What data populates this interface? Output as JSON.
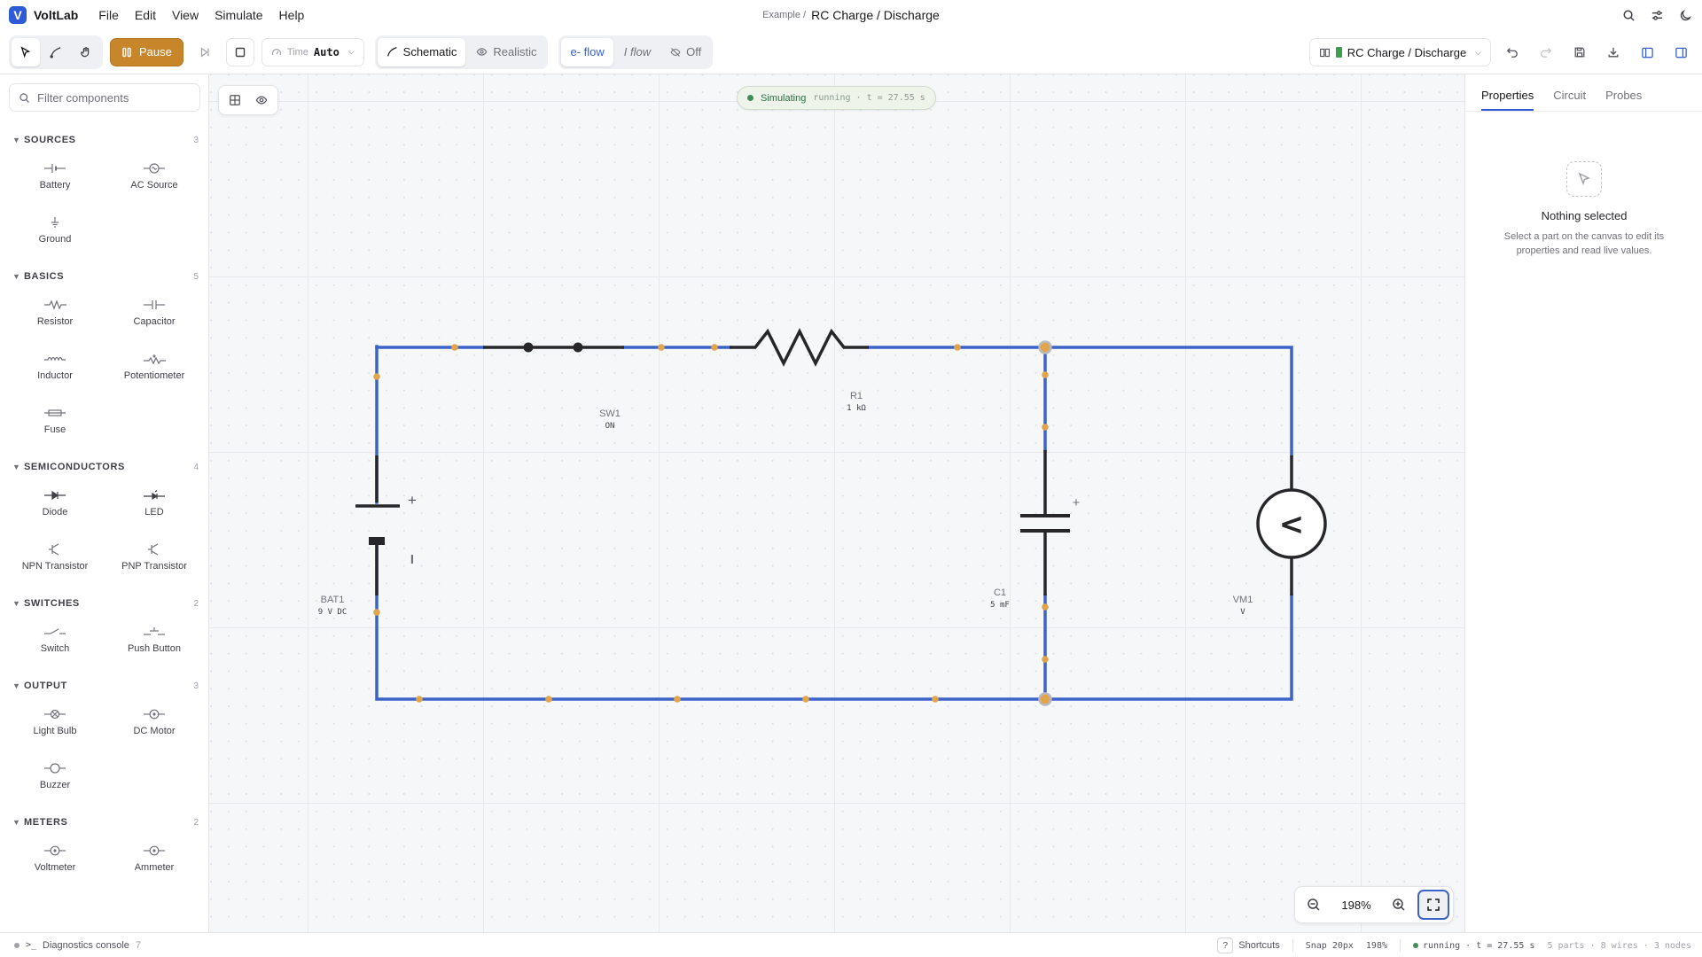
{
  "app": {
    "logo_letter": "V",
    "name": "VoltLab"
  },
  "menu": [
    "File",
    "Edit",
    "View",
    "Simulate",
    "Help"
  ],
  "title": {
    "prefix": "Example /",
    "name": "RC Charge / Discharge"
  },
  "toolbar": {
    "pause_label": "Pause",
    "time_label": "Time",
    "time_value": "Auto",
    "view_modes": [
      "Schematic",
      "Realistic"
    ],
    "active_view": "Schematic",
    "flow_modes": [
      "e- flow",
      "I flow",
      "Off"
    ],
    "active_flow": "e- flow",
    "project_name": "RC Charge / Discharge"
  },
  "filter": {
    "placeholder": "Filter components",
    "value": ""
  },
  "categories": [
    {
      "title": "SOURCES",
      "count": "3",
      "items": [
        "Battery",
        "AC Source",
        "Ground"
      ]
    },
    {
      "title": "BASICS",
      "count": "5",
      "items": [
        "Resistor",
        "Capacitor",
        "Inductor",
        "Potentiometer",
        "Fuse"
      ]
    },
    {
      "title": "SEMICONDUCTORS",
      "count": "4",
      "items": [
        "Diode",
        "LED",
        "NPN Transistor",
        "PNP Transistor"
      ]
    },
    {
      "title": "SWITCHES",
      "count": "2",
      "items": [
        "Switch",
        "Push Button"
      ]
    },
    {
      "title": "OUTPUT",
      "count": "3",
      "items": [
        "Light Bulb",
        "DC Motor",
        "Buzzer"
      ]
    },
    {
      "title": "METERS",
      "count": "2",
      "items": [
        "Voltmeter",
        "Ammeter"
      ]
    }
  ],
  "simulation": {
    "label": "Simulating",
    "detail": "running · t = 27.55 s"
  },
  "circuit": {
    "switch": {
      "name": "SW1",
      "value": "ON"
    },
    "resistor": {
      "name": "R1",
      "value": "1 kΩ"
    },
    "battery": {
      "name": "BAT1",
      "value": "9 V DC",
      "plus": "+",
      "minus": "I"
    },
    "capacitor": {
      "name": "C1",
      "value": "5 mF",
      "plus": "+"
    },
    "meter": {
      "name": "VM1",
      "value": "V",
      "glyph": "<"
    },
    "wire_color": "#3b63c9",
    "node_color": "#e2a54b"
  },
  "zoom": {
    "level": "198%"
  },
  "right_panel": {
    "tabs": [
      "Properties",
      "Circuit",
      "Probes"
    ],
    "active_tab": "Properties",
    "empty_title": "Nothing selected",
    "empty_desc": "Select a part on the canvas to edit its properties and read live values."
  },
  "statusbar": {
    "diagnostics_label": "Diagnostics console",
    "diagnostics_count": "7",
    "shortcuts_key": "?",
    "shortcuts_label": "Shortcuts",
    "snap": "Snap 20px",
    "zoom": "198%",
    "run_state": "running · t = 27.55 s",
    "counts": "5 parts · 8 wires · 3 nodes"
  },
  "icons": {
    "menubar": [
      "search-icon",
      "sliders-icon",
      "moon-icon"
    ],
    "tools": [
      "pointer-icon",
      "wire-icon",
      "hand-icon"
    ],
    "right": [
      "undo-icon",
      "redo-icon",
      "save-icon",
      "download-icon",
      "left-panel-icon",
      "right-panel-icon"
    ]
  }
}
